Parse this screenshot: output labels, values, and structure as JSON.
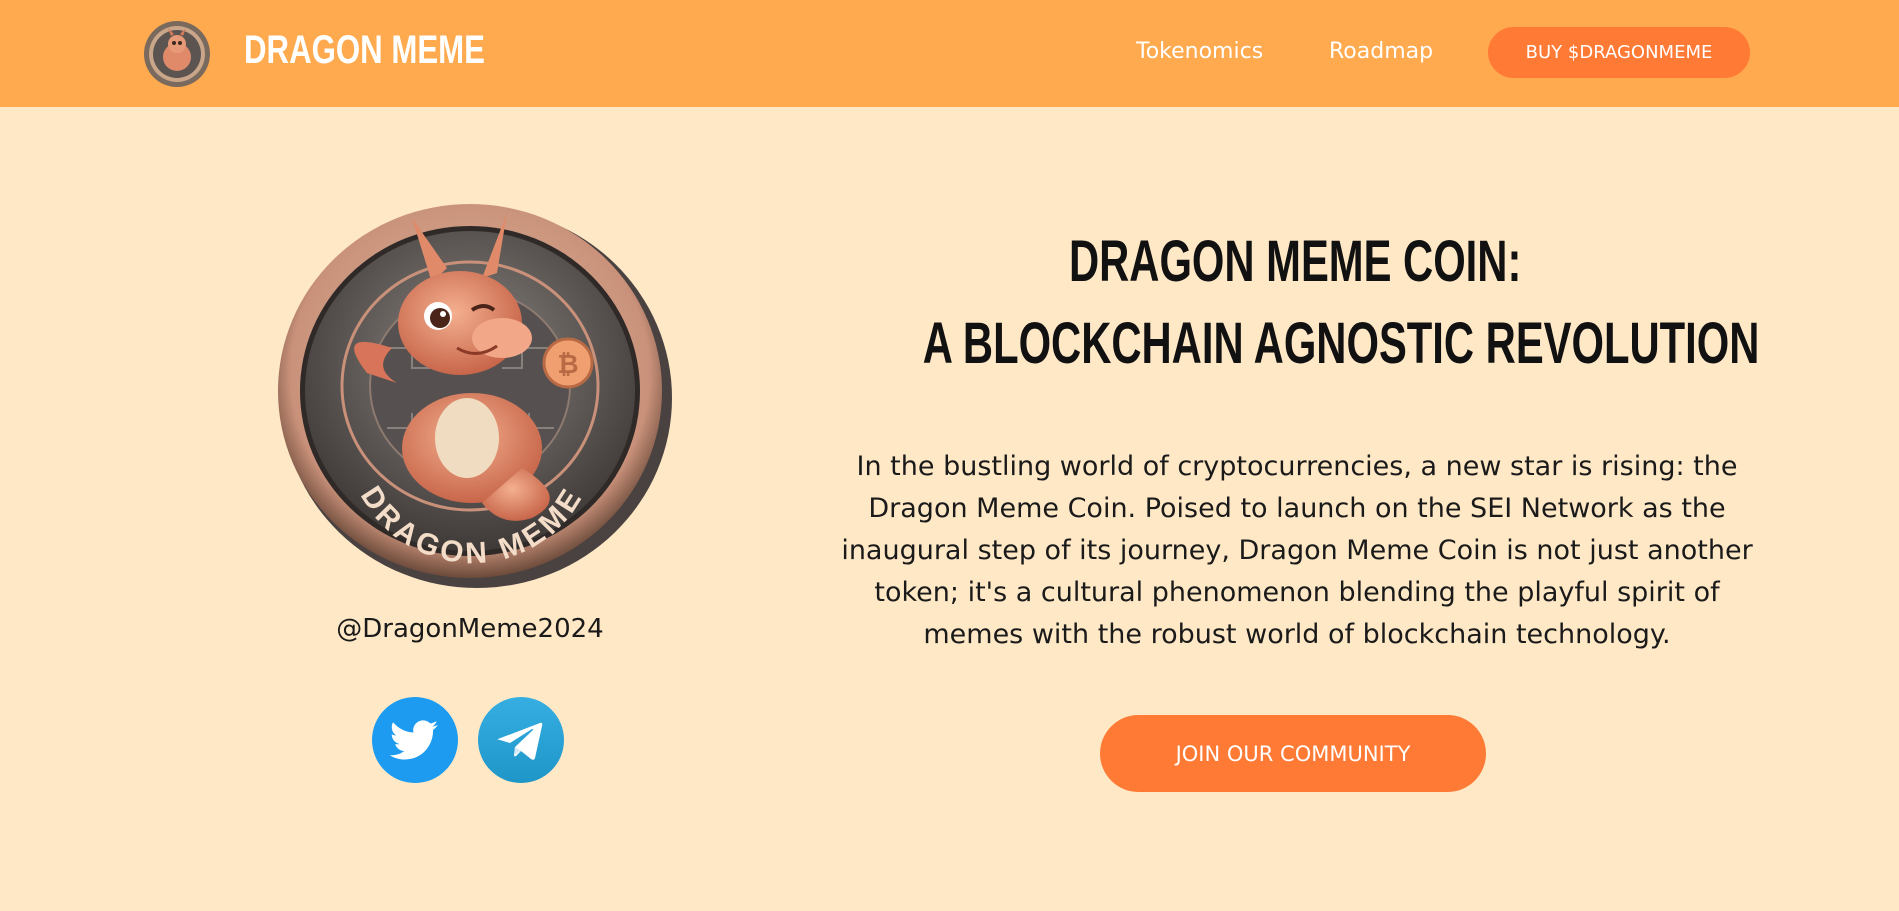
{
  "header": {
    "brand": "DRAGON MEME",
    "nav": {
      "tokenomics": "Tokenomics",
      "roadmap": "Roadmap",
      "buy": "BUY $DRAGONMEME"
    }
  },
  "hero": {
    "coin_text": "DRAGON MEME",
    "handle": "@DragonMeme2024",
    "title_line1": "DRAGON MEME COIN:",
    "title_line2": "A BLOCKCHAIN AGNOSTIC REVOLUTION",
    "description": "In the bustling world of cryptocurrencies, a new star is rising: the Dragon Meme Coin. Poised to launch on the SEI Network as the inaugural step of its journey, Dragon Meme Coin is not just another token; it's a cultural phenomenon blending the playful spirit of memes with the robust world of blockchain technology.",
    "cta": "JOIN OUR COMMUNITY"
  },
  "socials": [
    {
      "name": "twitter",
      "icon": "twitter-bird-icon",
      "color": "#1D9BF0"
    },
    {
      "name": "telegram",
      "icon": "telegram-plane-icon",
      "color": "#2AA3DA"
    }
  ],
  "colors": {
    "background": "#FFE8C6",
    "navbar": "#FFAA4F",
    "accent": "#FF7A35"
  }
}
